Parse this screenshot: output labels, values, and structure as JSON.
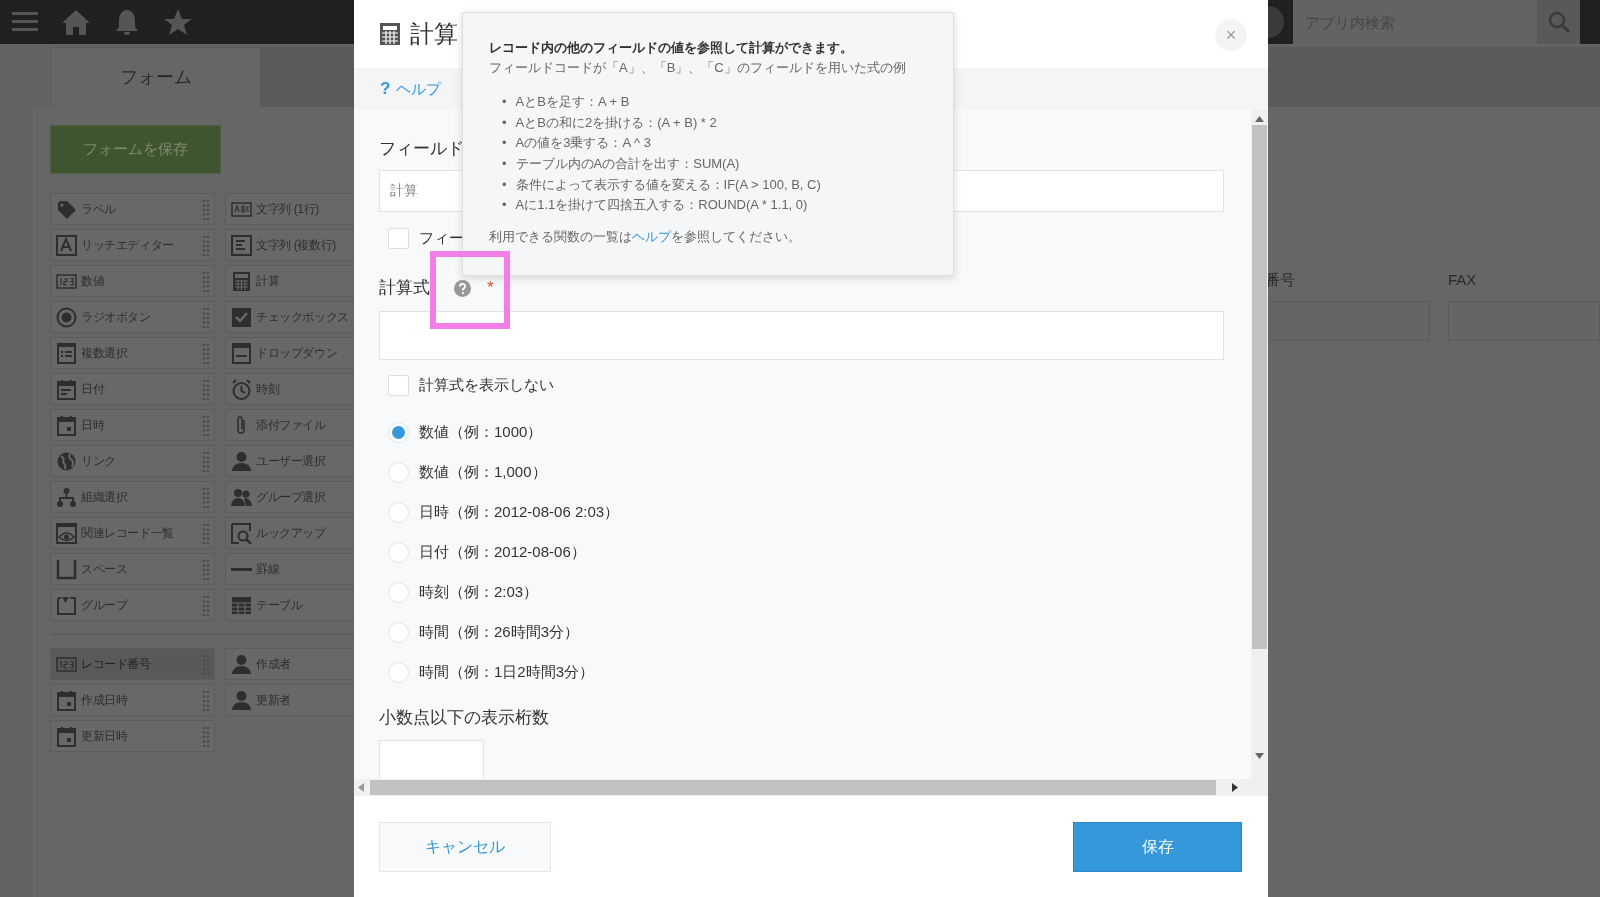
{
  "header": {
    "search": {
      "placeholder": "アプリ内検索"
    }
  },
  "tabs": [
    {
      "label": "フォーム",
      "selected": true
    },
    {
      "selected": false
    }
  ],
  "save_form_button": "フォームを保存",
  "palette": [
    {
      "label": "ラベル",
      "kind": "tag"
    },
    {
      "label": "文字列 (1行)",
      "kind": "abc"
    },
    {
      "label": "リッチエディター",
      "kind": "rich"
    },
    {
      "label": "文字列 (複数行)",
      "kind": "lines"
    },
    {
      "label": "数値",
      "kind": "num"
    },
    {
      "label": "計算",
      "kind": "calc"
    },
    {
      "label": "ラジオボタン",
      "kind": "radio"
    },
    {
      "label": "チェックボックス",
      "kind": "check"
    },
    {
      "label": "複数選択",
      "kind": "list"
    },
    {
      "label": "ドロップダウン",
      "kind": "dropdown"
    },
    {
      "label": "日付",
      "kind": "date"
    },
    {
      "label": "時刻",
      "kind": "clock"
    },
    {
      "label": "日時",
      "kind": "datetime"
    },
    {
      "label": "添付ファイル",
      "kind": "clip"
    },
    {
      "label": "リンク",
      "kind": "globe"
    },
    {
      "label": "ユーザー選択",
      "kind": "user"
    },
    {
      "label": "組織選択",
      "kind": "org"
    },
    {
      "label": "グループ選択",
      "kind": "users"
    },
    {
      "label": "関連レコード一覧",
      "kind": "eye"
    },
    {
      "label": "ルックアップ",
      "kind": "lookup"
    },
    {
      "label": "スペース",
      "kind": "space"
    },
    {
      "label": "罫線",
      "kind": "rule"
    },
    {
      "label": "グループ",
      "kind": "group"
    },
    {
      "label": "テーブル",
      "kind": "table"
    }
  ],
  "system_fields": [
    {
      "label": "レコード番号",
      "kind": "num",
      "disabled": true
    },
    {
      "label": "作成者",
      "kind": "user",
      "disabled": false
    },
    {
      "label": "作成日時",
      "kind": "datetime",
      "disabled": false
    },
    {
      "label": "更新者",
      "kind": "user",
      "disabled": false
    },
    {
      "label": "更新日時",
      "kind": "datetime",
      "disabled": false
    }
  ],
  "form_preview": [
    {
      "label": "番号"
    },
    {
      "label": "FAX"
    }
  ],
  "dialog": {
    "title": "計算",
    "close": "×",
    "help": {
      "icon": "?",
      "label": "ヘルプ"
    },
    "field_name": {
      "label": "フィールド",
      "value": "計算"
    },
    "hide_name": {
      "label": "フィー",
      "checked": false
    },
    "formula": {
      "label": "計算式",
      "required_mark": "*"
    },
    "hide_formula": {
      "label": "計算式を表示しない",
      "checked": false
    },
    "formats": [
      {
        "label": "数値（例：1000）",
        "selected": true
      },
      {
        "label": "数値（例：1,000）",
        "selected": false
      },
      {
        "label": "日時（例：2012-08-06 2:03）",
        "selected": false
      },
      {
        "label": "日付（例：2012-08-06）",
        "selected": false
      },
      {
        "label": "時刻（例：2:03）",
        "selected": false
      },
      {
        "label": "時間（例：26時間3分）",
        "selected": false
      },
      {
        "label": "時間（例：1日2時間3分）",
        "selected": false
      }
    ],
    "decimals": {
      "label": "小数点以下の表示桁数"
    },
    "cancel": "キャンセル",
    "save": "保存"
  },
  "tooltip": {
    "heading": "レコード内の他のフィールドの値を参照して計算ができます。",
    "subheading": "フィールドコードが「A」、「B」、「C」のフィールドを用いた式の例",
    "bullet": "•",
    "examples": [
      "AとBを足す：A + B",
      "AとBの和に2を掛ける：(A + B) * 2",
      "Aの値を3乗する：A ^ 3",
      "テーブル内のAの合計を出す：SUM(A)",
      "条件によって表示する値を変える：IF(A > 100, B, C)",
      "Aに1.1を掛けて四捨五入する：ROUND(A * 1.1, 0)"
    ],
    "footer": {
      "before": "利用できる関数の一覧は",
      "link": "ヘルプ",
      "after": "を参照してください。"
    }
  }
}
